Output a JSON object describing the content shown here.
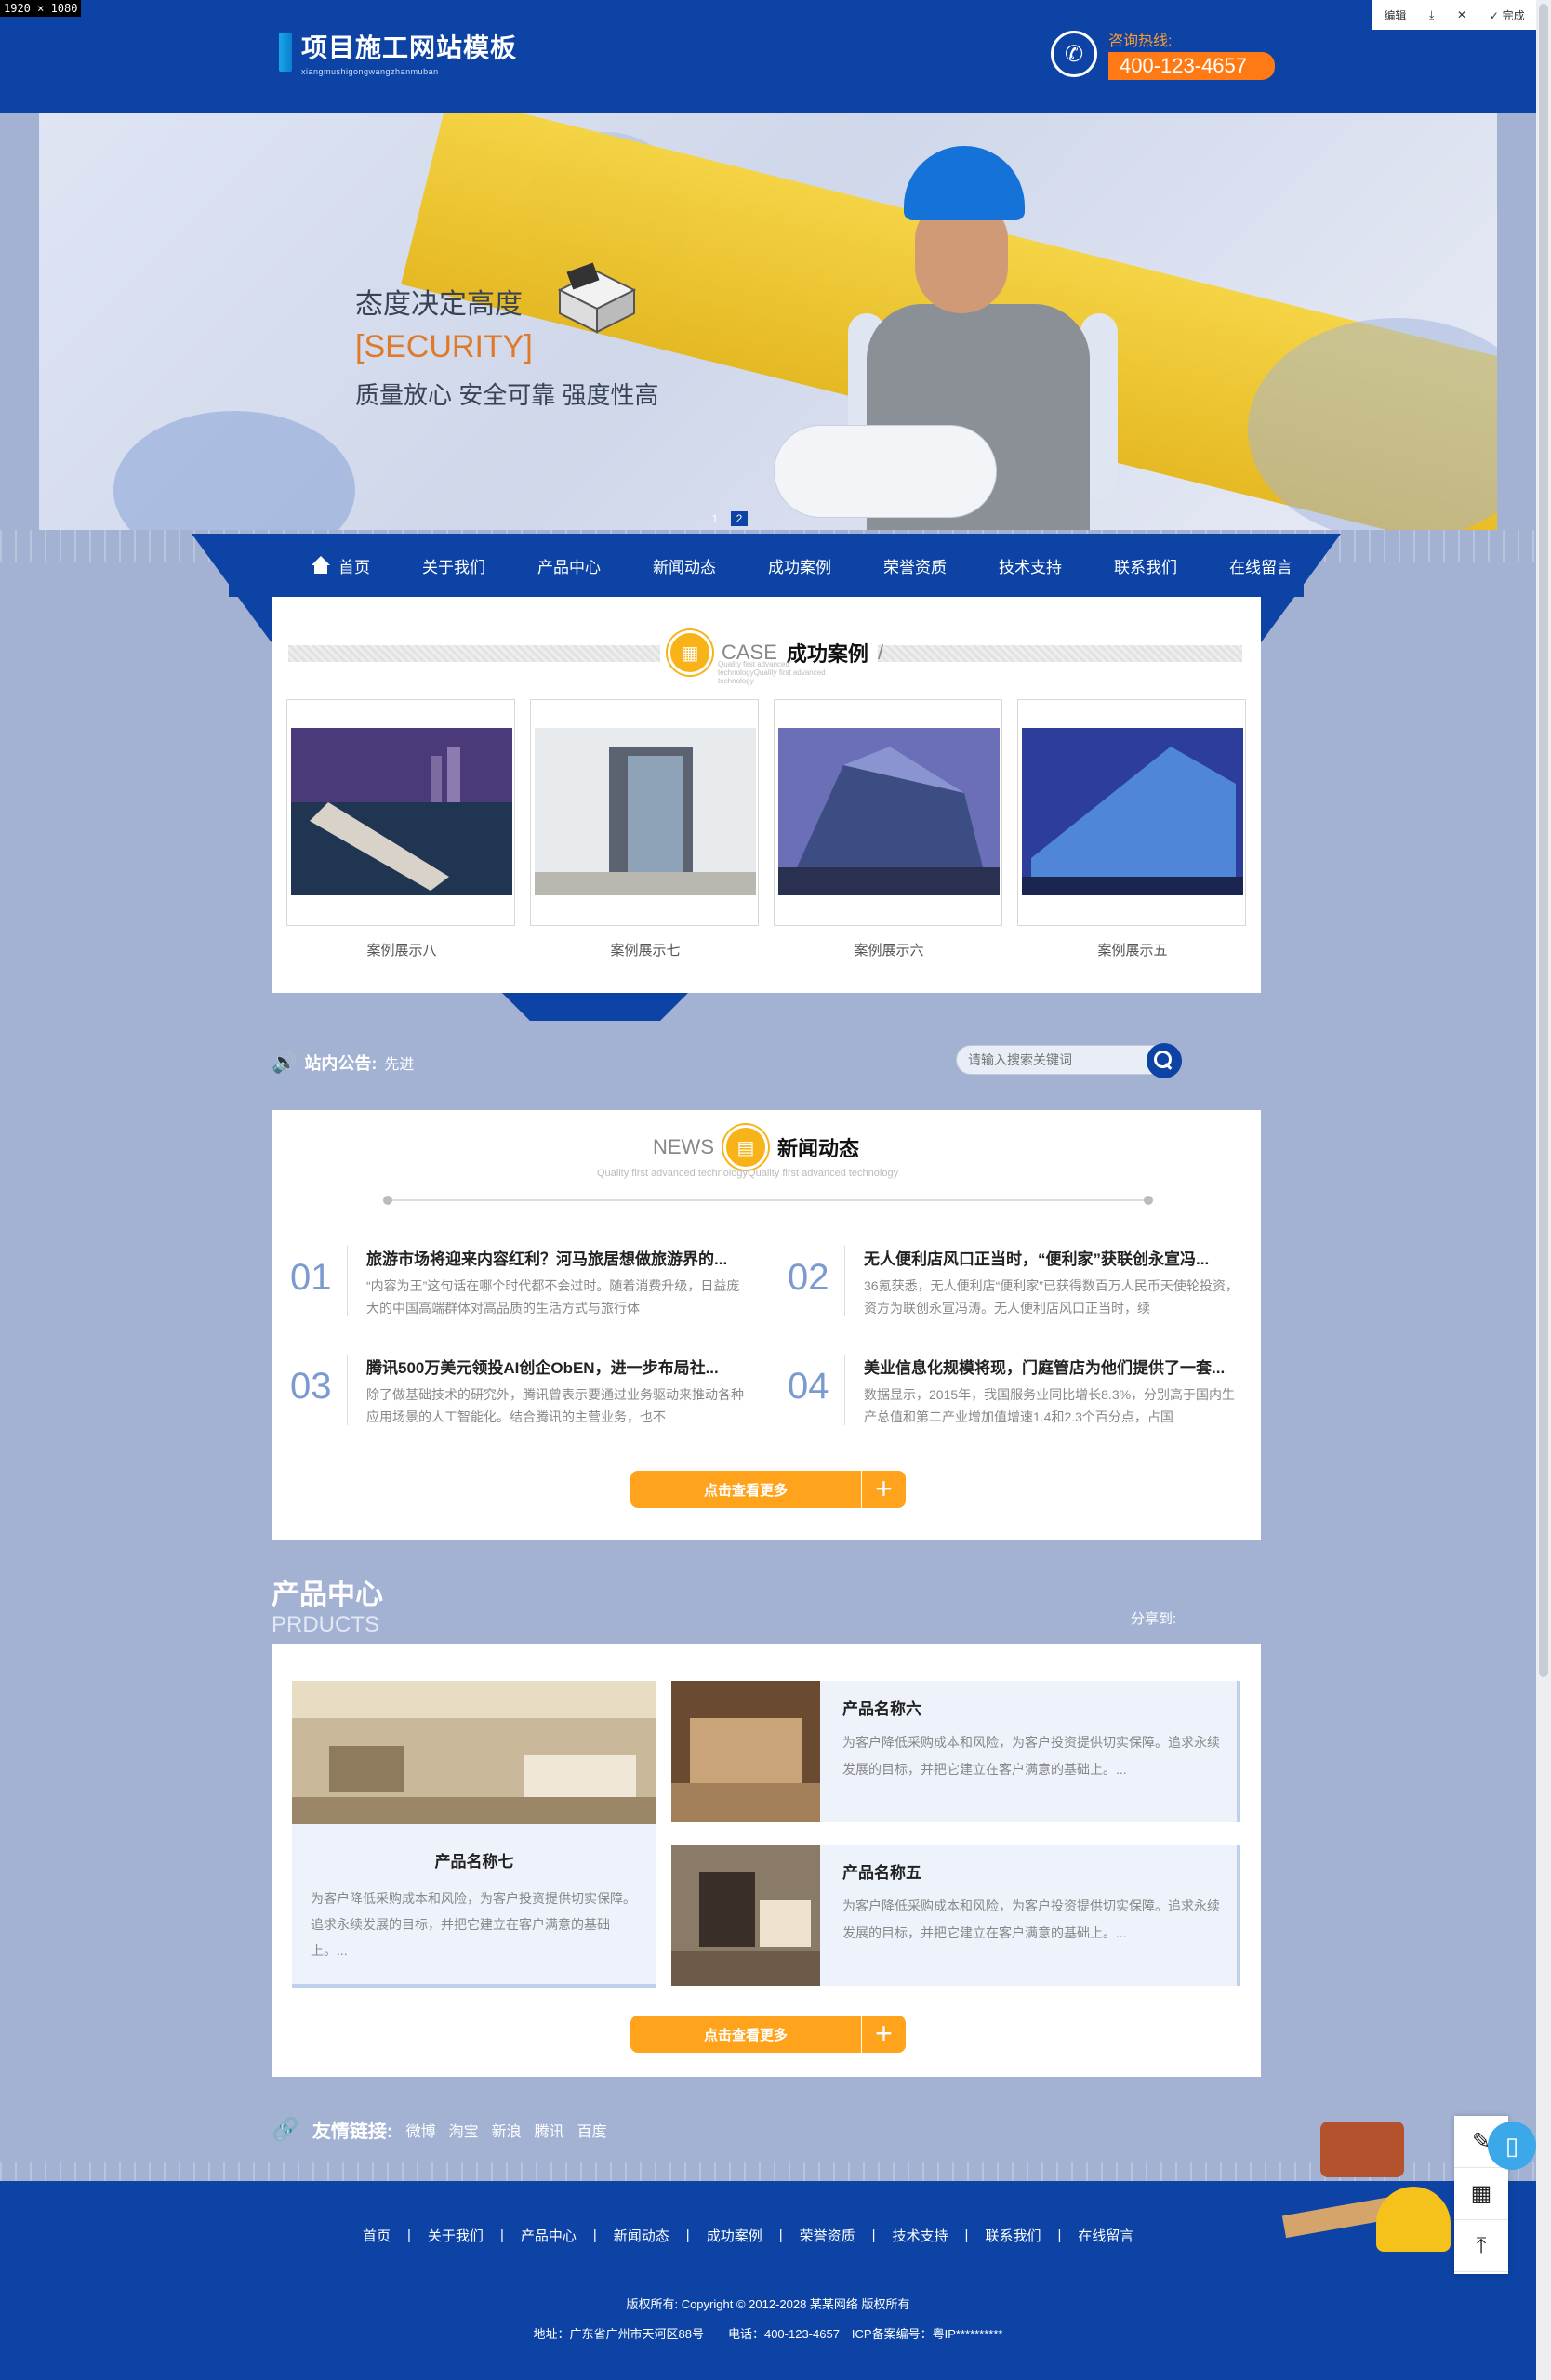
{
  "viewport_tag": "1920 × 1080",
  "toolbar": {
    "edit": "编辑",
    "download_icon": "download-icon",
    "close_icon": "close-icon",
    "done": "完成"
  },
  "header": {
    "logo_title": "项目施工网站模板",
    "logo_sub": "xiangmushigongwangzhanmuban",
    "hotline_label": "咨询热线:",
    "hotline_number": "400-123-4657"
  },
  "hero": {
    "line1": "态度决定高度",
    "line2": "[SECURITY]",
    "line3": "质量放心 安全可靠 强度性高",
    "dots": [
      "1",
      "2"
    ],
    "active_dot": 2
  },
  "nav": {
    "items": [
      "首页",
      "关于我们",
      "产品中心",
      "新闻动态",
      "成功案例",
      "荣誉资质",
      "技术支持",
      "联系我们",
      "在线留言"
    ]
  },
  "cases": {
    "en": "CASE",
    "cn": "成功案例",
    "sub": "Quality first advanced technologyQuality first advanced technology",
    "items": [
      "案例展示八",
      "案例展示七",
      "案例展示六",
      "案例展示五"
    ]
  },
  "notice": {
    "label": "站内公告:",
    "text": "先进"
  },
  "search": {
    "placeholder": "请输入搜索关键词"
  },
  "news": {
    "en": "NEWS",
    "cn": "新闻动态",
    "sub": "Quality first advanced technologyQuality first advanced technology",
    "items": [
      {
        "num": "01",
        "title": "旅游市场将迎来内容红利？河马旅居想做旅游界的...",
        "desc": "“内容为王”这句话在哪个时代都不会过时。随着消费升级，日益庞大的中国高端群体对高品质的生活方式与旅行体"
      },
      {
        "num": "02",
        "title": "无人便利店风口正当时，“便利家”获联创永宣冯...",
        "desc": "36氪获悉，无人便利店“便利家”已获得数百万人民币天使轮投资，资方为联创永宣冯涛。无人便利店风口正当时，续"
      },
      {
        "num": "03",
        "title": "腾讯500万美元领投AI创企ObEN，进一步布局社...",
        "desc": "除了做基础技术的研究外，腾讯曾表示要通过业务驱动来推动各种应用场景的人工智能化。结合腾讯的主营业务，也不"
      },
      {
        "num": "04",
        "title": "美业信息化规模将现，门庭管店为他们提供了一套...",
        "desc": "数据显示，2015年，我国服务业同比增长8.3%，分别高于国内生产总值和第二产业增加值增速1.4和2.3个百分点，占国"
      }
    ],
    "more": "点击查看更多"
  },
  "products": {
    "cn": "产品中心",
    "en": "PRDUCTS",
    "share": "分享到:",
    "big": {
      "name": "产品名称七",
      "desc": "为客户降低采购成本和风险，为客户投资提供切实保障。追求永续发展的目标，并把它建立在客户满意的基础上。..."
    },
    "small": [
      {
        "name": "产品名称六",
        "desc": "为客户降低采购成本和风险，为客户投资提供切实保障。追求永续发展的目标，并把它建立在客户满意的基础上。..."
      },
      {
        "name": "产品名称五",
        "desc": "为客户降低采购成本和风险，为客户投资提供切实保障。追求永续发展的目标，并把它建立在客户满意的基础上。..."
      }
    ],
    "more": "点击查看更多"
  },
  "links": {
    "label": "友情链接:",
    "items": [
      "微博",
      "淘宝",
      "新浪",
      "腾讯",
      "百度"
    ]
  },
  "footer": {
    "nav": [
      "首页",
      "关于我们",
      "产品中心",
      "新闻动态",
      "成功案例",
      "荣誉资质",
      "技术支持",
      "联系我们",
      "在线留言"
    ],
    "copyright": "版权所有: Copyright © 2012-2028 某某网络 版权所有",
    "address": "地址：广东省广州市天河区88号　　电话：400-123-4657　ICP备案编号：粤IP**********"
  },
  "side_tools": [
    "edit-icon",
    "qrcode-icon",
    "back-to-top-icon"
  ]
}
